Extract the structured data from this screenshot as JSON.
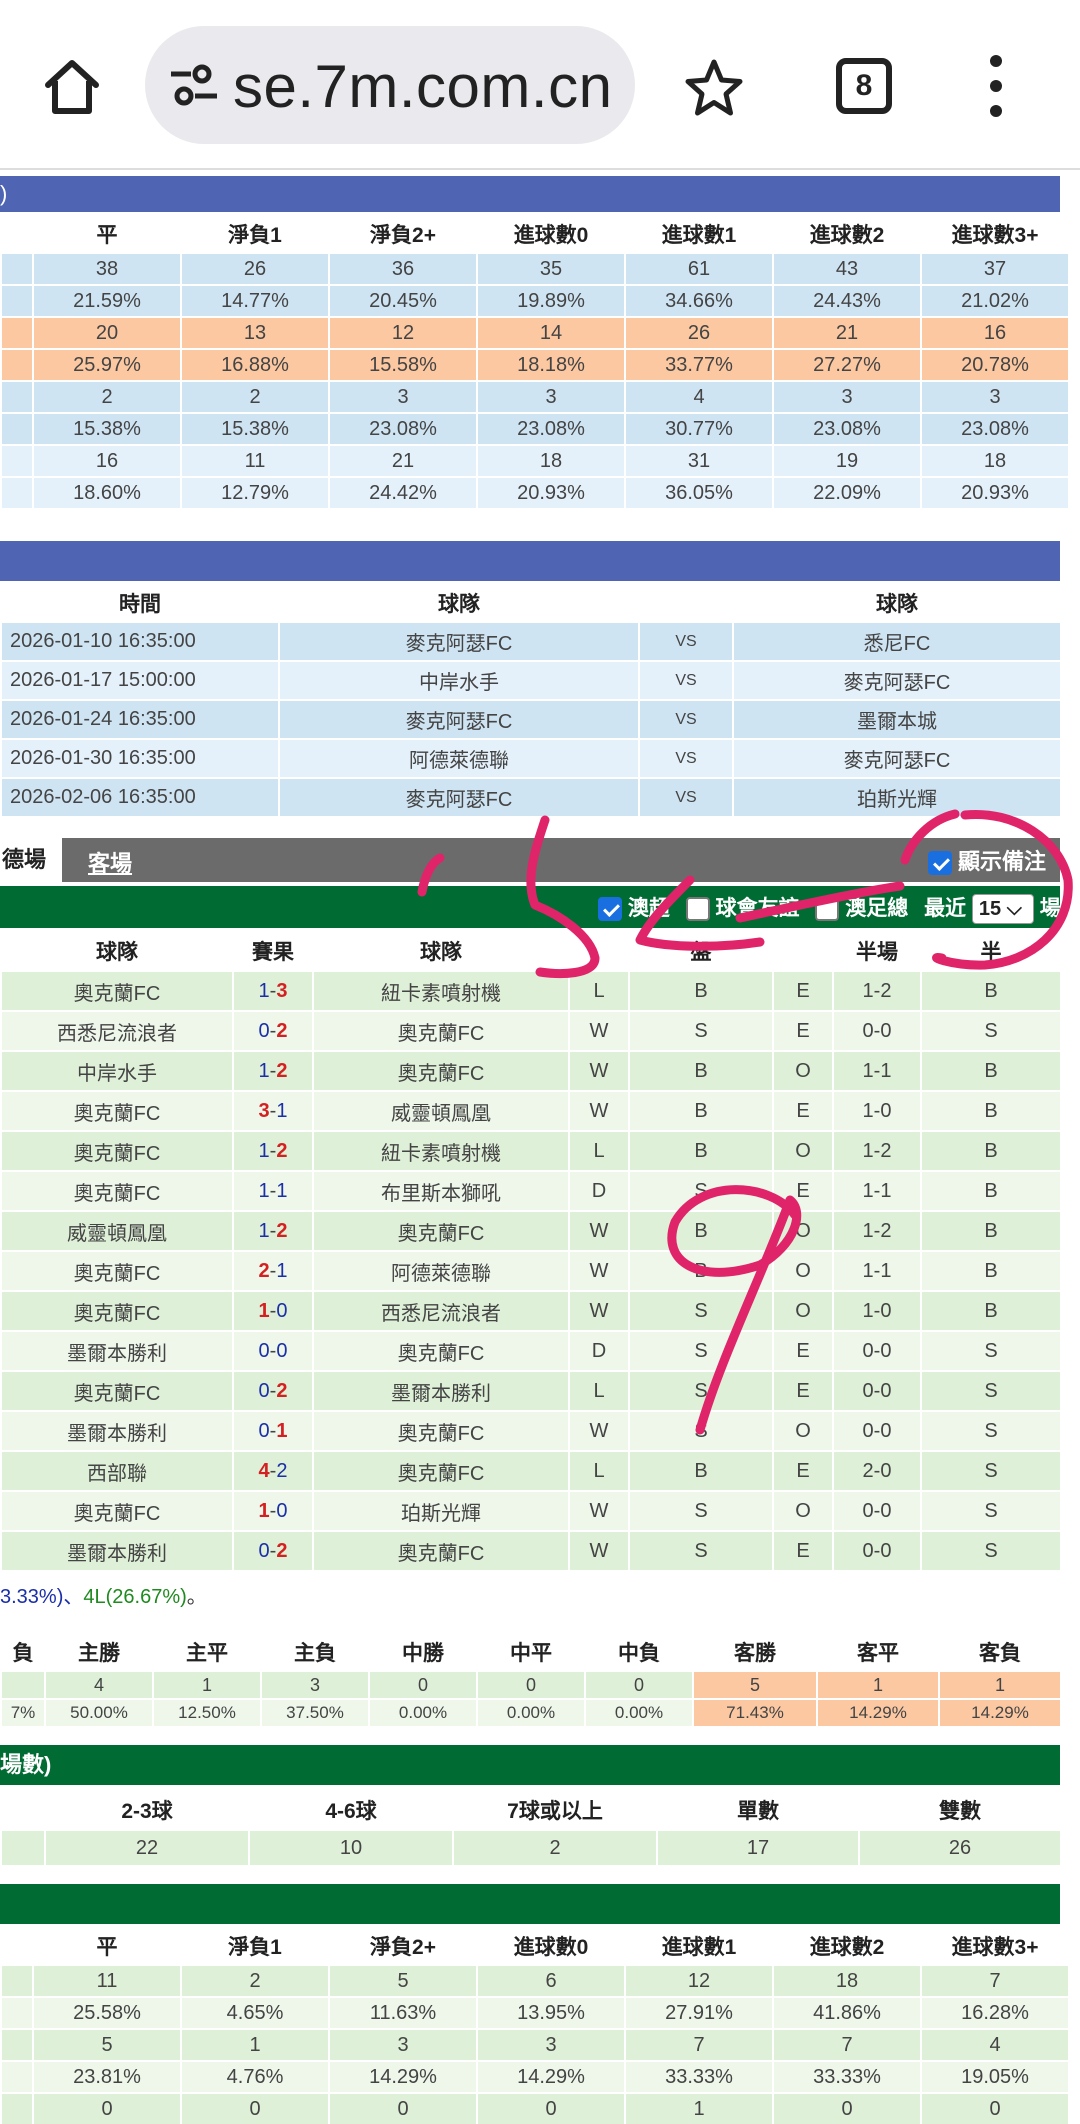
{
  "browser": {
    "url": "se.7m.com.cn",
    "tab_count": "8",
    "icons": [
      "home-icon",
      "site-settings-icon",
      "star-icon",
      "tab-switcher-icon",
      "more-menu-icon"
    ]
  },
  "stats1": {
    "headers": [
      "平",
      "淨負1",
      "淨負2+",
      "進球數0",
      "進球數1",
      "進球數2",
      "進球數3+"
    ],
    "rows": [
      {
        "style": "blue",
        "num": [
          "38",
          "26",
          "36",
          "35",
          "61",
          "43",
          "37"
        ],
        "pct": [
          "21.59%",
          "14.77%",
          "20.45%",
          "19.89%",
          "34.66%",
          "24.43%",
          "21.02%"
        ]
      },
      {
        "style": "orange",
        "num": [
          "20",
          "13",
          "12",
          "14",
          "26",
          "21",
          "16"
        ],
        "pct": [
          "25.97%",
          "16.88%",
          "15.58%",
          "18.18%",
          "33.77%",
          "27.27%",
          "20.78%"
        ]
      },
      {
        "style": "blue",
        "num": [
          "2",
          "2",
          "3",
          "3",
          "4",
          "3",
          "3"
        ],
        "pct": [
          "15.38%",
          "15.38%",
          "23.08%",
          "23.08%",
          "30.77%",
          "23.08%",
          "23.08%"
        ]
      },
      {
        "style": "blue2",
        "num": [
          "16",
          "11",
          "21",
          "18",
          "31",
          "19",
          "18"
        ],
        "pct": [
          "18.60%",
          "12.79%",
          "24.42%",
          "20.93%",
          "36.05%",
          "22.09%",
          "20.93%"
        ]
      }
    ]
  },
  "fixtures": {
    "headers": [
      "時間",
      "球隊",
      "",
      "球隊"
    ],
    "rows": [
      {
        "time": "2026-01-10 16:35:00",
        "home": "麥克阿瑟FC",
        "vs": "VS",
        "away": "悉尼FC"
      },
      {
        "time": "2026-01-17 15:00:00",
        "home": "中岸水手",
        "vs": "VS",
        "away": "麥克阿瑟FC"
      },
      {
        "time": "2026-01-24 16:35:00",
        "home": "麥克阿瑟FC",
        "vs": "VS",
        "away": "墨爾本城"
      },
      {
        "time": "2026-01-30 16:35:00",
        "home": "阿德萊德聯",
        "vs": "VS",
        "away": "麥克阿瑟FC"
      },
      {
        "time": "2026-02-06 16:35:00",
        "home": "麥克阿瑟FC",
        "vs": "VS",
        "away": "珀斯光輝"
      }
    ]
  },
  "tabs": {
    "home_partial": "德場數",
    "away": "客場",
    "show_notes": "顯示備注"
  },
  "filters": {
    "f1": "澳超",
    "f2": "球會友誼",
    "f3": "澳足總",
    "recent_label": "最近",
    "recent_value": "15",
    "recent_unit": "場"
  },
  "recent": {
    "headers": [
      "球隊",
      "賽果",
      "球隊",
      "",
      "盤",
      "",
      "半場",
      "半"
    ],
    "rows": [
      {
        "home": "奧克蘭FC",
        "hc": "g",
        "s1": "1",
        "s2": "3",
        "win": "r",
        "away": "紐卡素噴射機",
        "ac": "",
        "res": "L",
        "pan": "B",
        "ou": "E",
        "half": "1-2",
        "hb": "B"
      },
      {
        "home": "西悉尼流浪者",
        "hc": "",
        "s1": "0",
        "s2": "2",
        "win": "r",
        "away": "奧克蘭FC",
        "ac": "r",
        "res": "W",
        "pan": "S",
        "ou": "E",
        "half": "0-0",
        "hb": "S"
      },
      {
        "home": "中岸水手",
        "hc": "",
        "s1": "1",
        "s2": "2",
        "win": "r",
        "away": "奧克蘭FC",
        "ac": "r",
        "res": "W",
        "pan": "B",
        "ou": "O",
        "half": "1-1",
        "hb": "B"
      },
      {
        "home": "奧克蘭FC",
        "hc": "r",
        "s1": "3",
        "s2": "1",
        "win": "l",
        "away": "威靈頓鳳凰",
        "ac": "",
        "res": "W",
        "pan": "B",
        "ou": "E",
        "half": "1-0",
        "hb": "B"
      },
      {
        "home": "奧克蘭FC",
        "hc": "g",
        "s1": "1",
        "s2": "2",
        "win": "r",
        "away": "紐卡素噴射機",
        "ac": "",
        "res": "L",
        "pan": "B",
        "ou": "O",
        "half": "1-2",
        "hb": "B"
      },
      {
        "home": "奧克蘭FC",
        "hc": "b",
        "s1": "1",
        "s2": "1",
        "win": "n",
        "away": "布里斯本獅吼",
        "ac": "",
        "res": "D",
        "pan": "S",
        "ou": "E",
        "half": "1-1",
        "hb": "B"
      },
      {
        "home": "威靈頓鳳凰",
        "hc": "",
        "s1": "1",
        "s2": "2",
        "win": "r",
        "away": "奧克蘭FC",
        "ac": "r",
        "res": "W",
        "pan": "B",
        "ou": "O",
        "half": "1-2",
        "hb": "B"
      },
      {
        "home": "奧克蘭FC",
        "hc": "r",
        "s1": "2",
        "s2": "1",
        "win": "l",
        "away": "阿德萊德聯",
        "ac": "",
        "res": "W",
        "pan": "B",
        "ou": "O",
        "half": "1-1",
        "hb": "B"
      },
      {
        "home": "奧克蘭FC",
        "hc": "r",
        "s1": "1",
        "s2": "0",
        "win": "l",
        "away": "西悉尼流浪者",
        "ac": "",
        "res": "W",
        "pan": "S",
        "ou": "O",
        "half": "1-0",
        "hb": "B"
      },
      {
        "home": "墨爾本勝利",
        "hc": "",
        "s1": "0",
        "s2": "0",
        "win": "n",
        "away": "奧克蘭FC",
        "ac": "b",
        "res": "D",
        "pan": "S",
        "ou": "E",
        "half": "0-0",
        "hb": "S"
      },
      {
        "home": "奧克蘭FC",
        "hc": "g",
        "s1": "0",
        "s2": "2",
        "win": "r",
        "away": "墨爾本勝利",
        "ac": "",
        "res": "L",
        "pan": "S",
        "ou": "E",
        "half": "0-0",
        "hb": "S"
      },
      {
        "home": "墨爾本勝利",
        "hc": "",
        "s1": "0",
        "s2": "1",
        "win": "r",
        "away": "奧克蘭FC",
        "ac": "r",
        "res": "W",
        "pan": "S",
        "ou": "O",
        "half": "0-0",
        "hb": "S"
      },
      {
        "home": "西部聯",
        "hc": "",
        "s1": "4",
        "s2": "2",
        "win": "l",
        "away": "奧克蘭FC",
        "ac": "g",
        "res": "L",
        "pan": "B",
        "ou": "E",
        "half": "2-0",
        "hb": "S"
      },
      {
        "home": "奧克蘭FC",
        "hc": "r",
        "s1": "1",
        "s2": "0",
        "win": "l",
        "away": "珀斯光輝",
        "ac": "",
        "res": "W",
        "pan": "S",
        "ou": "O",
        "half": "0-0",
        "hb": "S"
      },
      {
        "home": "墨爾本勝利",
        "hc": "",
        "s1": "0",
        "s2": "2",
        "win": "r",
        "away": "奧克蘭FC",
        "ac": "r",
        "res": "W",
        "pan": "S",
        "ou": "E",
        "half": "0-0",
        "hb": "S"
      }
    ],
    "summary_a": "3.33%)、",
    "summary_b": "4L(26.67%)",
    "summary_c": "。"
  },
  "hda": {
    "headers": [
      "負",
      "主勝",
      "主平",
      "主負",
      "中勝",
      "中平",
      "中負",
      "客勝",
      "客平",
      "客負"
    ],
    "num": [
      "",
      "4",
      "1",
      "3",
      "0",
      "0",
      "0",
      "5",
      "1",
      "1"
    ],
    "pct": [
      "7%",
      "50.00%",
      "12.50%",
      "37.50%",
      "0.00%",
      "0.00%",
      "0.00%",
      "71.43%",
      "14.29%",
      "14.29%"
    ]
  },
  "goals": {
    "title": "場數)",
    "headers": [
      "",
      "2-3球",
      "4-6球",
      "7球或以上",
      "單數",
      "雙數"
    ],
    "values": [
      "",
      "22",
      "10",
      "2",
      "17",
      "26"
    ]
  },
  "stats2": {
    "headers": [
      "平",
      "淨負1",
      "淨負2+",
      "進球數0",
      "進球數1",
      "進球數2",
      "進球數3+"
    ],
    "rows": [
      {
        "num": [
          "11",
          "2",
          "5",
          "6",
          "12",
          "18",
          "7"
        ],
        "pct": [
          "25.58%",
          "4.65%",
          "11.63%",
          "13.95%",
          "27.91%",
          "41.86%",
          "16.28%"
        ]
      },
      {
        "num": [
          "5",
          "1",
          "3",
          "3",
          "7",
          "7",
          "4"
        ],
        "pct": [
          "23.81%",
          "4.76%",
          "14.29%",
          "14.29%",
          "33.33%",
          "33.33%",
          "19.05%"
        ]
      },
      {
        "num": [
          "0",
          "0",
          "0",
          "0",
          "1",
          "0",
          "0"
        ],
        "pct": []
      }
    ]
  },
  "colors": {
    "blue_bar": "#4f65b3",
    "green_bar": "#006b33",
    "grey_bar": "#6b6b6b",
    "light_blue": "#cfe4f3",
    "orange": "#fbc8a2",
    "light_green": "#dff0d8",
    "ink": "#e0246a"
  }
}
